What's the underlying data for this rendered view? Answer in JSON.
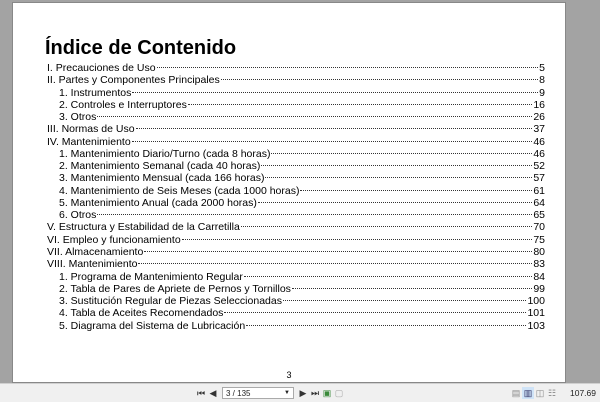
{
  "document": {
    "title": "Índice de Contenido",
    "page_footer": "3",
    "entries": [
      {
        "label": "I. Precauciones de Uso",
        "page": "5",
        "level": 1
      },
      {
        "label": "II. Partes y Componentes Principales",
        "page": "8",
        "level": 1
      },
      {
        "label": "1. Instrumentos",
        "page": "9",
        "level": 2
      },
      {
        "label": "2. Controles e Interruptores",
        "page": "16",
        "level": 2
      },
      {
        "label": "3. Otros",
        "page": "26",
        "level": 2
      },
      {
        "label": "III. Normas de Uso",
        "page": "37",
        "level": 1
      },
      {
        "label": "IV. Mantenimiento",
        "page": "46",
        "level": 1
      },
      {
        "label": "1. Mantenimiento Diario/Turno (cada 8 horas)",
        "page": "46",
        "level": 2
      },
      {
        "label": "2. Mantenimiento Semanal (cada 40 horas)",
        "page": "52",
        "level": 2
      },
      {
        "label": "3. Mantenimiento Mensual (cada 166 horas)",
        "page": "57",
        "level": 2
      },
      {
        "label": "4. Mantenimiento de Seis Meses (cada 1000 horas)",
        "page": "61",
        "level": 2
      },
      {
        "label": "5. Mantenimiento Anual (cada 2000 horas)",
        "page": "64",
        "level": 2
      },
      {
        "label": "6. Otros",
        "page": "65",
        "level": 2
      },
      {
        "label": "V. Estructura y Estabilidad de la Carretilla",
        "page": "70",
        "level": 1
      },
      {
        "label": "VI. Empleo y funcionamiento",
        "page": "75",
        "level": 1
      },
      {
        "label": "VII. Almacenamiento",
        "page": "80",
        "level": 1
      },
      {
        "label": "VIII. Mantenimiento",
        "page": "83",
        "level": 1
      },
      {
        "label": "1. Programa de Mantenimiento Regular",
        "page": "84",
        "level": 2
      },
      {
        "label": "2. Tabla de Pares de Apriete de Pernos y Tornillos",
        "page": "99",
        "level": 2
      },
      {
        "label": "3. Sustitución Regular de Piezas Seleccionadas",
        "page": "100",
        "level": 2
      },
      {
        "label": "4. Tabla de Aceites Recomendados",
        "page": "101",
        "level": 2
      },
      {
        "label": "5. Diagrama del Sistema de Lubricación",
        "page": "103",
        "level": 2
      }
    ]
  },
  "toolbar": {
    "page_indicator": "3 / 135",
    "zoom_level": "107.69",
    "icons": [
      "first-page-icon",
      "prev-page-icon",
      "next-page-icon",
      "last-page-icon",
      "fit-page-icon",
      "fit-width-icon",
      "single-page-icon",
      "continuous-icon",
      "two-page-icon",
      "two-page-continuous-icon"
    ]
  }
}
